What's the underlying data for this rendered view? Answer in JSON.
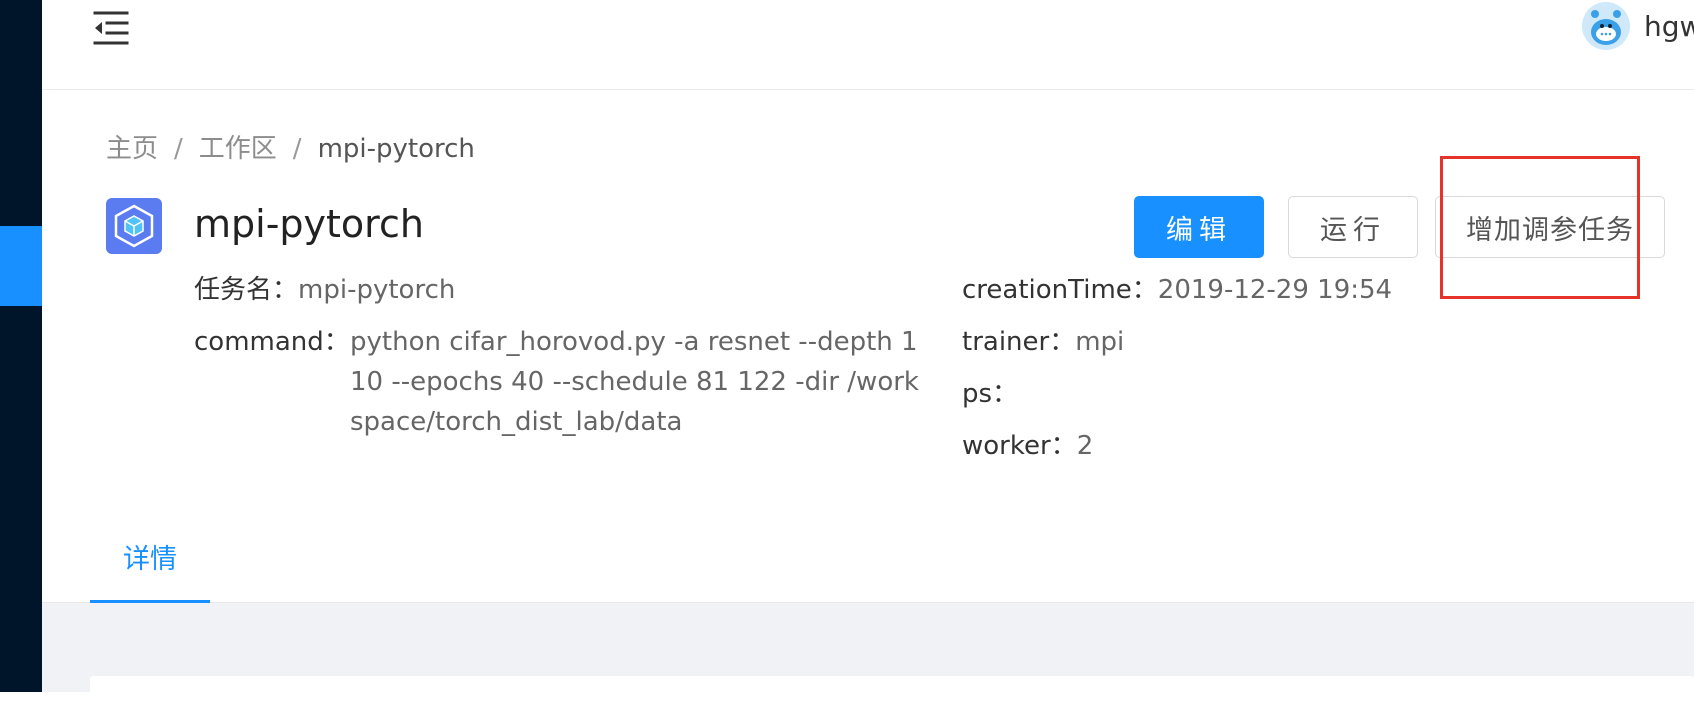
{
  "header": {
    "username": "hgwang"
  },
  "breadcrumb": {
    "items": [
      "主页",
      "工作区",
      "mpi-pytorch"
    ],
    "separator": "/"
  },
  "page": {
    "title": "mpi-pytorch"
  },
  "actions": {
    "edit_label": "编辑",
    "run_label": "运行",
    "add_tuning_label": "增加调参任务"
  },
  "fields": {
    "task_name_key": "任务名：",
    "task_name_value": "mpi-pytorch",
    "command_key": "command：",
    "command_value": "python cifar_horovod.py -a resnet --depth 110 --epochs 40 --schedule 81 122 -dir /workspace/torch_dist_lab/data",
    "creation_time_key": "creationTime：",
    "creation_time_value": "2019-12-29 19:54",
    "trainer_key": "trainer：",
    "trainer_value": "mpi",
    "ps_key": "ps：",
    "ps_value": "",
    "worker_key": "worker：",
    "worker_value": "2"
  },
  "tabs": [
    {
      "label": "详情",
      "active": true
    }
  ],
  "colors": {
    "primary": "#1890ff",
    "sidebar": "#001529",
    "highlight": "#e5332a",
    "page_bg": "#f0f2f5"
  },
  "icons": {
    "menu": "menu-fold-icon",
    "logo": "cube-icon",
    "avatar": "avatar-bird"
  }
}
